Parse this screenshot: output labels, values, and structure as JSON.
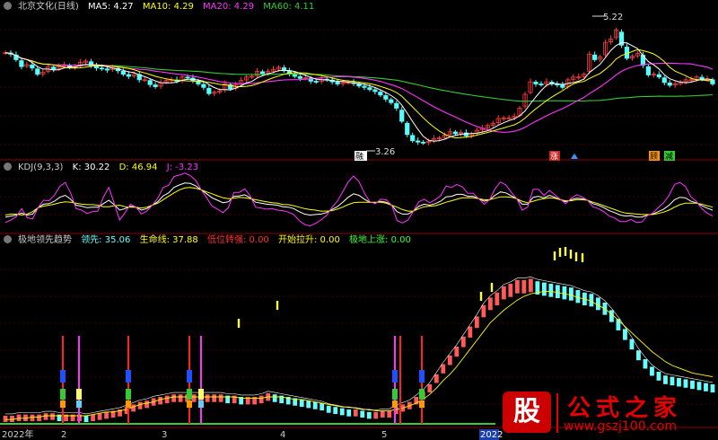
{
  "header1": {
    "title": "北京文化(日线)",
    "ma": [
      {
        "label": "MA5:",
        "value": "4.27",
        "color": "#ffffff"
      },
      {
        "label": "MA10:",
        "value": "4.29",
        "color": "#ffff00"
      },
      {
        "label": "MA20:",
        "value": "4.29",
        "color": "#ff33ff"
      },
      {
        "label": "MA60:",
        "value": "4.11",
        "color": "#33cc33"
      }
    ]
  },
  "header2": {
    "title": "KDJ(9,3,3)",
    "k": {
      "label": "K:",
      "value": "30.22",
      "color": "#ffffff"
    },
    "d": {
      "label": "D:",
      "value": "46.94",
      "color": "#ffff00"
    },
    "j": {
      "label": "J:",
      "value": "-3.23",
      "color": "#ff33ff"
    }
  },
  "header3": {
    "title": "极地领先趋势",
    "items": [
      {
        "label": "领先:",
        "value": "35.06",
        "color": "#66ffff"
      },
      {
        "label": "生命线:",
        "value": "37.88",
        "color": "#ffff00"
      },
      {
        "label": "低位转强:",
        "value": "0.00",
        "color": "#ff3333"
      },
      {
        "label": "开始拉升:",
        "value": "0.00",
        "color": "#ffff00"
      },
      {
        "label": "极地上涨:",
        "value": "0.00",
        "color": "#33ff33"
      }
    ]
  },
  "annotations": {
    "high": "5.22",
    "low": "3.26",
    "signal_low": "融",
    "signal_zhang": "涨",
    "signal_gu": "顾",
    "signal_jian": "减"
  },
  "x_axis": [
    "2022年",
    "2",
    "3",
    "4",
    "5",
    "2022"
  ],
  "watermark": {
    "logo": "股",
    "title": "公式之家",
    "url": "www.gszj100.com"
  },
  "colors": {
    "up": "#ff3b3b",
    "down": "#54ffff",
    "grid": "#8b0000",
    "ma5": "#ffffff",
    "ma10": "#ffff00",
    "ma20": "#ff33ff",
    "ma60": "#33cc33"
  },
  "chart_data": [
    {
      "type": "candlestick",
      "title": "北京文化(日线)",
      "ylim": [
        3.2,
        5.3
      ],
      "close": [
        4.72,
        4.7,
        4.62,
        4.52,
        4.55,
        4.5,
        4.41,
        4.44,
        4.52,
        4.48,
        4.53,
        4.54,
        4.51,
        4.52,
        4.58,
        4.6,
        4.53,
        4.5,
        4.49,
        4.47,
        4.5,
        4.46,
        4.41,
        4.38,
        4.42,
        4.33,
        4.33,
        4.26,
        4.23,
        4.29,
        4.32,
        4.33,
        4.31,
        4.37,
        4.36,
        4.32,
        4.27,
        4.22,
        4.13,
        4.15,
        4.17,
        4.27,
        4.2,
        4.26,
        4.32,
        4.37,
        4.38,
        4.45,
        4.42,
        4.45,
        4.48,
        4.51,
        4.46,
        4.42,
        4.38,
        4.35,
        4.36,
        4.31,
        4.3,
        4.34,
        4.33,
        4.3,
        4.27,
        4.29,
        4.29,
        4.28,
        4.24,
        4.22,
        4.19,
        4.16,
        4.11,
        4.05,
        4.0,
        3.92,
        3.73,
        3.54,
        3.45,
        3.43,
        3.42,
        3.44,
        3.48,
        3.49,
        3.53,
        3.58,
        3.55,
        3.57,
        3.52,
        3.55,
        3.6,
        3.63,
        3.67,
        3.7,
        3.77,
        3.78,
        3.78,
        3.8,
        3.92,
        4.12,
        4.3,
        4.27,
        4.26,
        4.3,
        4.27,
        4.26,
        4.22,
        4.33,
        4.37,
        4.37,
        4.41,
        4.7,
        4.62,
        4.66,
        4.87,
        4.92,
        5.05,
        4.83,
        4.64,
        4.67,
        4.71,
        4.54,
        4.4,
        4.41,
        4.37,
        4.29,
        4.25,
        4.27,
        4.3,
        4.33,
        4.33,
        4.37,
        4.34,
        4.34,
        4.27
      ]
    },
    {
      "type": "line",
      "title": "KDJ(9,3,3)",
      "series": [
        {
          "name": "K",
          "values": [
            16,
            18,
            20,
            24,
            20,
            22,
            35,
            42,
            43,
            48,
            56,
            60,
            52,
            40,
            38,
            35,
            36,
            36,
            43,
            50,
            41,
            30,
            33,
            38,
            36,
            30,
            33,
            40,
            47,
            59,
            65,
            76,
            81,
            85,
            84,
            79,
            71,
            63,
            55,
            50,
            45,
            47,
            58,
            59,
            61,
            55,
            46,
            44,
            42,
            41,
            40,
            37,
            36,
            33,
            27,
            22,
            20,
            21,
            22,
            25,
            31,
            37,
            46,
            56,
            63,
            60,
            52,
            46,
            45,
            48,
            46,
            40,
            27,
            22,
            22,
            28,
            38,
            42,
            40,
            43,
            48,
            57,
            58,
            62,
            62,
            58,
            58,
            53,
            48,
            51,
            60,
            67,
            65,
            59,
            53,
            42,
            42,
            56,
            58,
            55,
            60,
            56,
            51,
            47,
            51,
            54,
            53,
            50,
            43,
            40,
            35,
            29,
            25,
            20,
            18,
            19,
            16,
            16,
            20,
            22,
            27,
            32,
            40,
            51,
            56,
            55,
            48,
            45,
            39,
            34,
            30
          ]
        },
        {
          "name": "D",
          "values": [
            20,
            22,
            22,
            20,
            22,
            27,
            35,
            38,
            40,
            42,
            45,
            47,
            46,
            44,
            42,
            41,
            41,
            40,
            37,
            37,
            39,
            40,
            37,
            36,
            36,
            34,
            36,
            40,
            44,
            51,
            58,
            65,
            71,
            75,
            76,
            74,
            71,
            67,
            63,
            59,
            55,
            53,
            54,
            56,
            55,
            53,
            51,
            49,
            47,
            45,
            44,
            41,
            41,
            39,
            36,
            33,
            31,
            30,
            28,
            28,
            29,
            32,
            36,
            41,
            45,
            46,
            46,
            46,
            46,
            46,
            44,
            40,
            36,
            31,
            28,
            28,
            33,
            37,
            38,
            39,
            42,
            46,
            49,
            52,
            55,
            55,
            55,
            53,
            51,
            51,
            54,
            57,
            57,
            56,
            53,
            48,
            45,
            48,
            51,
            53,
            55,
            54,
            51,
            49,
            49,
            51,
            51,
            50,
            46,
            43,
            39,
            35,
            31,
            27,
            24,
            23,
            22,
            21,
            21,
            21,
            23,
            26,
            30,
            36,
            41,
            44,
            44,
            44,
            42,
            39,
            36
          ]
        },
        {
          "name": "J",
          "values": [
            5,
            10,
            17,
            33,
            15,
            12,
            35,
            50,
            49,
            60,
            78,
            86,
            65,
            33,
            30,
            23,
            27,
            28,
            56,
            76,
            44,
            10,
            25,
            42,
            36,
            22,
            28,
            40,
            54,
            76,
            80,
            98,
            101,
            105,
            100,
            90,
            71,
            55,
            38,
            32,
            25,
            35,
            66,
            66,
            73,
            59,
            36,
            34,
            32,
            33,
            30,
            29,
            26,
            21,
            9,
            1,
            -2,
            3,
            10,
            19,
            35,
            48,
            67,
            87,
            99,
            88,
            64,
            47,
            43,
            52,
            51,
            40,
            9,
            4,
            10,
            28,
            47,
            52,
            45,
            51,
            59,
            79,
            76,
            82,
            77,
            64,
            64,
            53,
            42,
            51,
            73,
            87,
            81,
            66,
            53,
            30,
            36,
            72,
            72,
            60,
            70,
            61,
            52,
            43,
            54,
            61,
            57,
            50,
            37,
            33,
            27,
            18,
            14,
            7,
            7,
            11,
            5,
            6,
            19,
            24,
            35,
            45,
            60,
            82,
            86,
            78,
            57,
            48,
            33,
            24,
            18
          ]
        }
      ]
    },
    {
      "type": "bar",
      "title": "极地领先趋势",
      "series": [
        {
          "name": "领先",
          "values": [
            5,
            5,
            6,
            6,
            6,
            6,
            7,
            7,
            6,
            6,
            6,
            6,
            5,
            6,
            7,
            8,
            9,
            10,
            12,
            14,
            16,
            17,
            19,
            20,
            21,
            22,
            22,
            22,
            22,
            22,
            22,
            22,
            22,
            21,
            21,
            20,
            20,
            20,
            21,
            23,
            22,
            21,
            20,
            19,
            18,
            17,
            16,
            15,
            13,
            12,
            11,
            10,
            10,
            9,
            8,
            8,
            9,
            9,
            12,
            14,
            16,
            20,
            24,
            30,
            38,
            46,
            53,
            60,
            68,
            76,
            84,
            93,
            99,
            103,
            108,
            110,
            113,
            113,
            114,
            112,
            111,
            110,
            109,
            108,
            107,
            105,
            103,
            102,
            99,
            95,
            89,
            82,
            74,
            66,
            57,
            50,
            44,
            40,
            37,
            36,
            35,
            34,
            33,
            32,
            31,
            30
          ]
        },
        {
          "name": "生命线",
          "values": [
            2,
            2,
            3,
            3,
            4,
            4,
            5,
            5,
            5,
            5,
            5,
            5,
            5,
            6,
            7,
            8,
            8,
            9,
            10,
            12,
            14,
            15,
            16,
            18,
            19,
            20,
            20,
            20,
            20,
            20,
            20,
            20,
            20,
            20,
            20,
            19,
            19,
            19,
            19,
            20,
            20,
            20,
            19,
            18,
            18,
            17,
            16,
            15,
            14,
            13,
            12,
            12,
            11,
            10,
            10,
            9,
            9,
            9,
            10,
            11,
            13,
            15,
            18,
            22,
            27,
            33,
            38,
            44,
            51,
            58,
            65,
            72,
            79,
            84,
            89,
            93,
            97,
            100,
            102,
            103,
            104,
            104,
            103,
            102,
            101,
            99,
            98,
            96,
            93,
            90,
            86,
            81,
            76,
            71,
            66,
            61,
            56,
            52,
            48,
            45,
            43,
            41,
            39,
            38,
            37,
            36
          ]
        }
      ]
    }
  ]
}
